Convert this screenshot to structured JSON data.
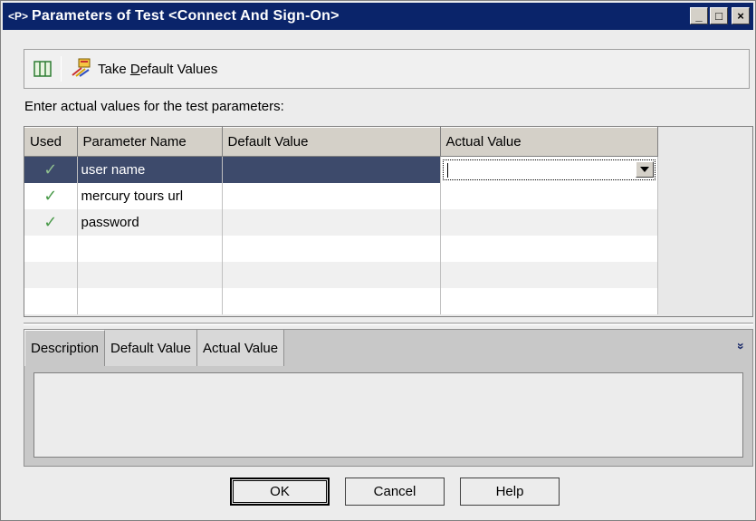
{
  "window": {
    "title": "Parameters of Test <Connect And Sign-On>",
    "title_icon": "parameters-icon",
    "title_icon_text": "<P>",
    "minimize_glyph": "_",
    "maximize_glyph": "□",
    "close_glyph": "×"
  },
  "toolbar": {
    "columns_icon": "columns-icon",
    "take_default_icon": "take-default-values-icon",
    "take_default_prefix": "Take ",
    "take_default_mnemonic": "D",
    "take_default_suffix": "efault Values"
  },
  "instruction": "Enter actual values for the test parameters:",
  "grid": {
    "columns": [
      "Used",
      "Parameter Name",
      "Default Value",
      "Actual Value"
    ],
    "rows": [
      {
        "used": "✓",
        "name": "user name",
        "default": "",
        "actual": "",
        "selected": true
      },
      {
        "used": "✓",
        "name": "mercury tours url",
        "default": "",
        "actual": ""
      },
      {
        "used": "✓",
        "name": "password",
        "default": "",
        "actual": ""
      }
    ]
  },
  "tabs": [
    {
      "label": "Description",
      "active": true
    },
    {
      "label": "Default Value"
    },
    {
      "label": "Actual Value"
    }
  ],
  "expand_glyph": "»",
  "buttons": {
    "ok": "OK",
    "cancel": "Cancel",
    "help": "Help"
  },
  "colors": {
    "titlebar": "#0a246a",
    "selected_row": "#3d4a6b",
    "check": "#4a9a4a"
  }
}
